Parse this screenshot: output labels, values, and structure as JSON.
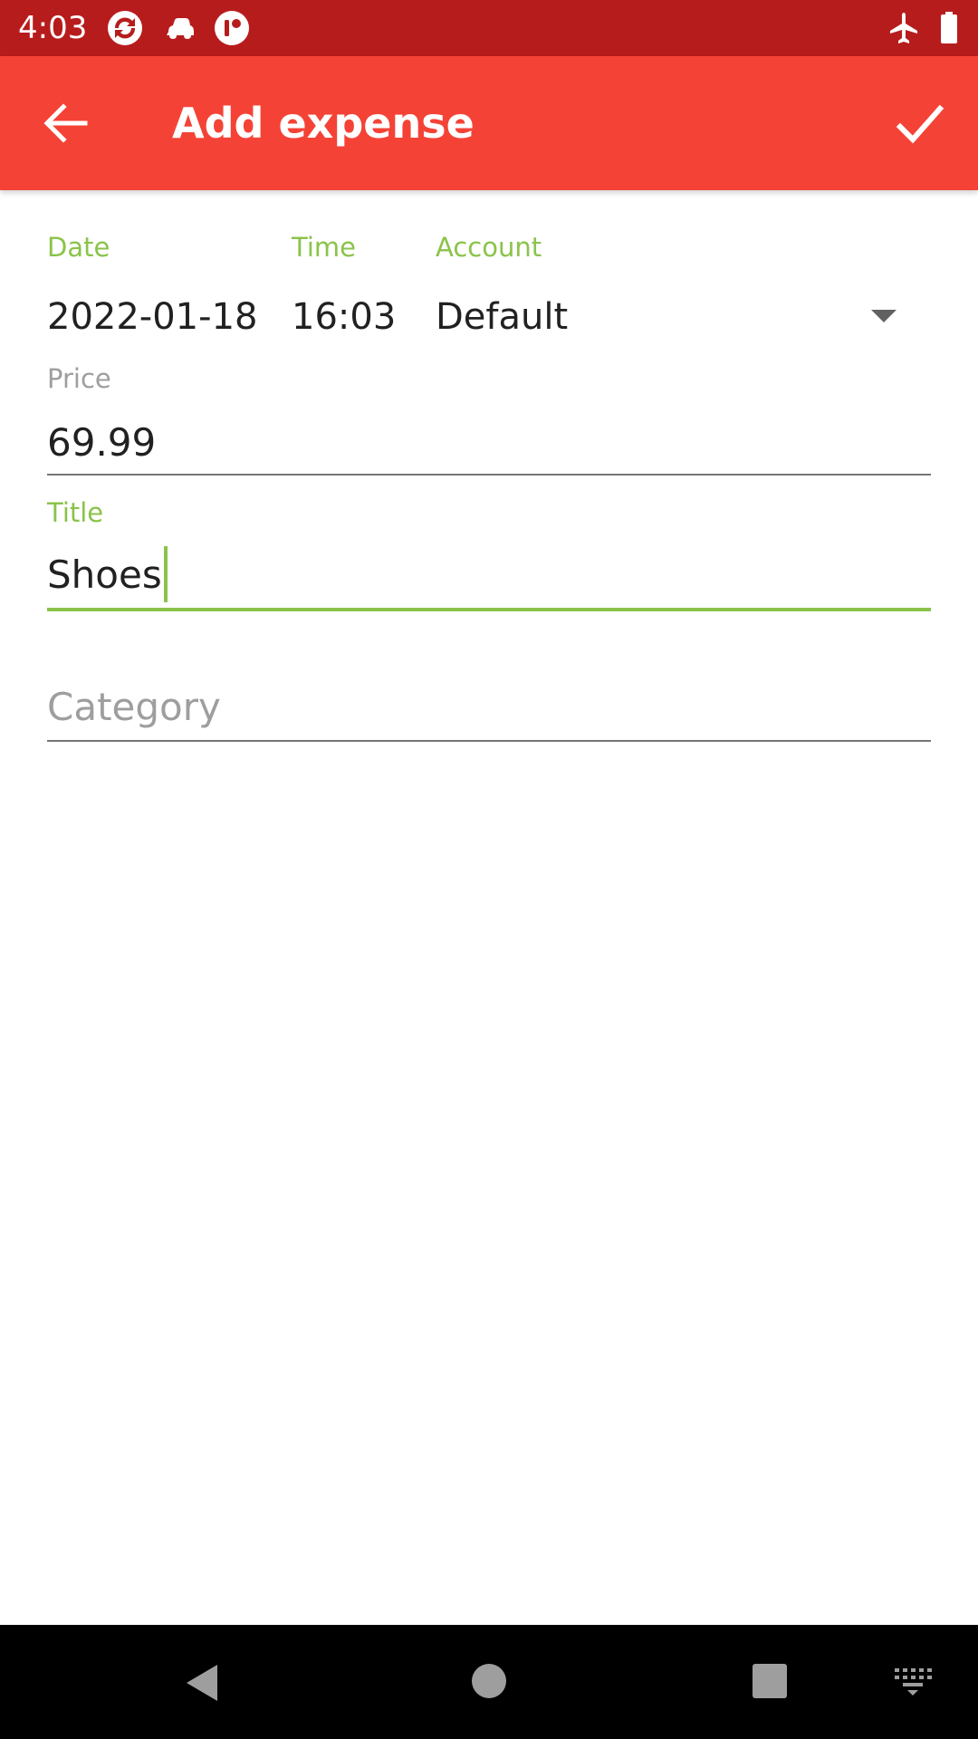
{
  "status_bar": {
    "time": "4:03",
    "icons_left": [
      "sync-app-icon",
      "car-app-icon",
      "info-app-icon"
    ],
    "icons_right": [
      "airplane-mode-icon",
      "battery-icon"
    ]
  },
  "app_bar": {
    "title": "Add expense",
    "back_icon": "arrow-back-icon",
    "confirm_icon": "check-icon",
    "background_color": "#f44336",
    "status_color": "#b71c1c"
  },
  "form": {
    "date": {
      "label": "Date",
      "value": "2022-01-18"
    },
    "time": {
      "label": "Time",
      "value": "16:03"
    },
    "account": {
      "label": "Account",
      "value": "Default"
    },
    "price": {
      "label": "Price",
      "value": "69.99"
    },
    "title": {
      "label": "Title",
      "value": "Shoes",
      "focused": true
    },
    "category": {
      "placeholder": "Category",
      "value": ""
    },
    "accent_color": "#8bc34a"
  },
  "nav_bar": {
    "buttons": [
      "back-nav-icon",
      "home-nav-icon",
      "recents-nav-icon",
      "keyboard-icon"
    ]
  }
}
